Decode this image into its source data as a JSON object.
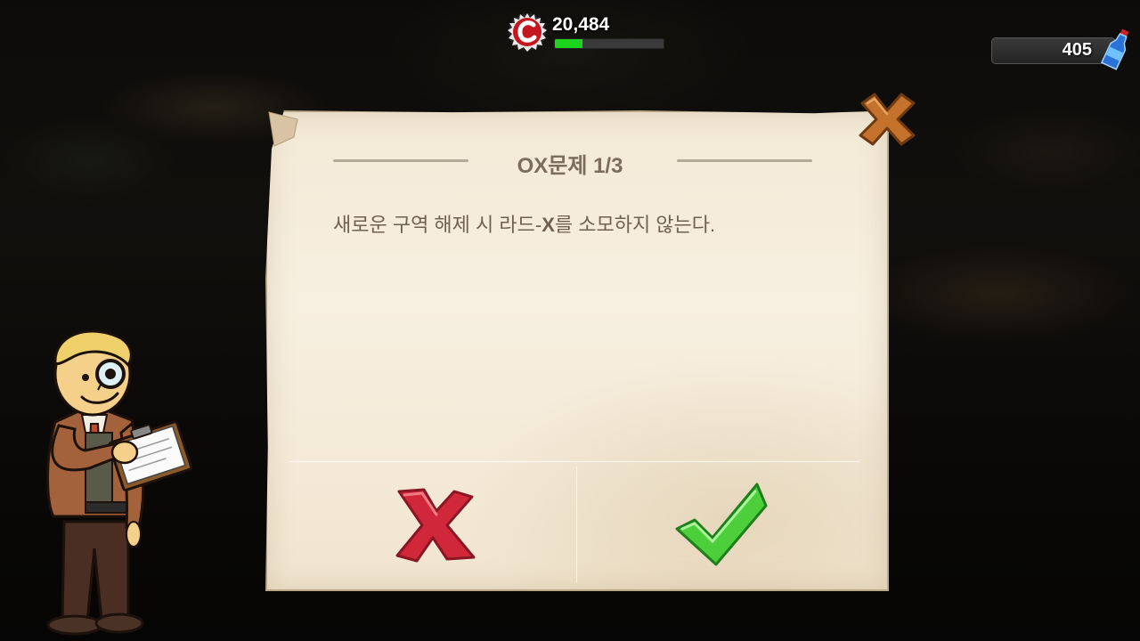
{
  "hud": {
    "caps": "20,484",
    "xp_progress": 0.25,
    "quantum": "405"
  },
  "quiz": {
    "title": "OX문제 1/3",
    "question_before": "새로운 구역 해제 시 라드-",
    "question_bold": "X",
    "question_after": "를 소모하지 않는다."
  },
  "icons": {
    "caps": "bottle-cap-icon",
    "quantum": "nuka-quantum-icon",
    "close": "close-x-icon",
    "false_answer": "red-x-icon",
    "true_answer": "green-check-icon"
  },
  "colors": {
    "xp": "#1ed51e",
    "wrong": "#d0283a",
    "right": "#4ccf3a",
    "close": "#c4722c"
  }
}
